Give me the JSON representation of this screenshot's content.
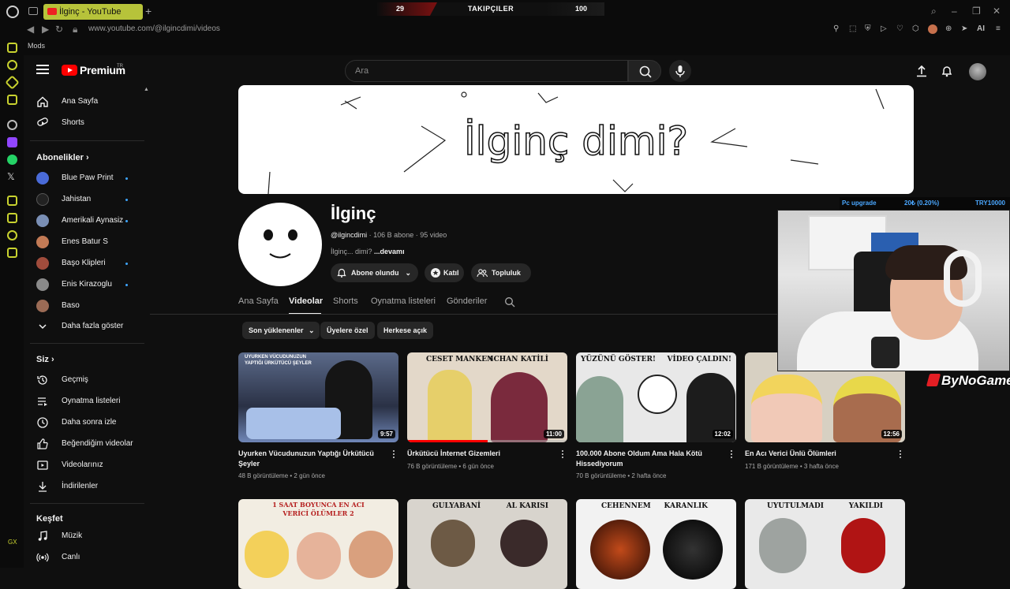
{
  "browser": {
    "tab_title": "İlginç - YouTube",
    "url": "www.youtube.com/@ilgincdimi/videos",
    "bookmark": "Mods",
    "gx_label": "GX",
    "ai_label": "AI"
  },
  "stream_overlay": {
    "left_count": "29",
    "title": "TAKIPÇILER",
    "right_count": "100",
    "goal_label": "Pc upgrade",
    "goal_progress": "20₺ (0.20%)",
    "goal_target": "TRY10000",
    "watermark": "ByNoGame"
  },
  "youtube": {
    "logo_text": "Premium",
    "logo_country": "TR",
    "search_placeholder": "Ara",
    "guide": {
      "main": [
        "Ana Sayfa",
        "Shorts"
      ],
      "subs_title": "Abonelikler",
      "subs": [
        {
          "name": "Blue Paw Print",
          "dot": true,
          "color": "#4a6bd8"
        },
        {
          "name": "Jahistan",
          "dot": true,
          "color": "#222222"
        },
        {
          "name": "Amerikali Aynasiz",
          "dot": true,
          "color": "#7a8fb5"
        },
        {
          "name": "Enes Batur S",
          "dot": false,
          "color": "#c27a55"
        },
        {
          "name": "Başo Klipleri",
          "dot": true,
          "color": "#a04c3c"
        },
        {
          "name": "Enis Kirazoglu",
          "dot": true,
          "color": "#8a8a8a"
        },
        {
          "name": "Baso",
          "dot": false,
          "color": "#9b6b55"
        }
      ],
      "show_more": "Daha fazla göster",
      "you_title": "Siz",
      "you": [
        "Geçmiş",
        "Oynatma listeleri",
        "Daha sonra izle",
        "Beğendiğim videolar",
        "Videolarınız",
        "İndirilenler"
      ],
      "explore_title": "Keşfet",
      "explore": [
        "Müzik",
        "Canlı"
      ]
    },
    "channel": {
      "name": "İlginç",
      "handle": "@ilgincdimi",
      "subs": "106 B abone",
      "videos": "95 video",
      "desc": "İlginç... dimi?",
      "more": "...devamı",
      "subscribe_btn": "Abone olundu",
      "join_btn": "Katıl",
      "community_btn": "Topluluk",
      "banner_text": "İlginç dimi?"
    },
    "tabs": [
      "Ana Sayfa",
      "Videolar",
      "Shorts",
      "Oynatma listeleri",
      "Gönderiler"
    ],
    "active_tab": "Videolar",
    "chips": [
      "Son yüklenenler",
      "Üyelere özel",
      "Herkese açık"
    ],
    "videos": [
      {
        "title": "Uyurken Vücudunuzun Yaptığı Ürkütücü Şeyler",
        "views": "48 B görüntüleme",
        "age": "2 gün önce",
        "duration": "9:57",
        "caption_left": "UYURKEN VÜCUDUNUZUN YAPTIĞI ÜRKÜTÜCÜ ŞEYLER",
        "caption_right": "",
        "watched": 0
      },
      {
        "title": "Ürkütücü İnternet Gizemleri",
        "views": "76 B görüntüleme",
        "age": "6 gün önce",
        "duration": "11:00",
        "caption_left": "CESET MANKEN",
        "caption_right": "4CHAN KATİLİ",
        "watched": 0.5
      },
      {
        "title": "100.000 Abone Oldum Ama Hala Kötü Hissediyorum",
        "views": "70 B görüntüleme",
        "age": "2 hafta önce",
        "duration": "12:02",
        "caption_left": "YÜZÜNÜ GÖSTER!",
        "caption_right": "VİDEO ÇALDIN!",
        "watched": 0
      },
      {
        "title": "En Acı Verici Ünlü Ölümleri",
        "views": "171 B görüntüleme",
        "age": "3 hafta önce",
        "duration": "12:56",
        "caption_left": "",
        "caption_right": "",
        "watched": 0
      },
      {
        "title": "",
        "views": "",
        "age": "",
        "duration": "",
        "caption_left": "1 SAAT BOYUNCA EN ACI VERİCİ ÖLÜMLER 2",
        "caption_right": "",
        "watched": 0
      },
      {
        "title": "",
        "views": "",
        "age": "",
        "duration": "",
        "caption_left": "GULYABANİ",
        "caption_right": "AL KARISI",
        "watched": 0
      },
      {
        "title": "",
        "views": "",
        "age": "",
        "duration": "",
        "caption_left": "CEHENNEM",
        "caption_right": "KARANLIK",
        "watched": 0
      },
      {
        "title": "",
        "views": "",
        "age": "",
        "duration": "",
        "caption_left": "UYUTULMADI",
        "caption_right": "YAKILDI",
        "watched": 0
      }
    ]
  }
}
